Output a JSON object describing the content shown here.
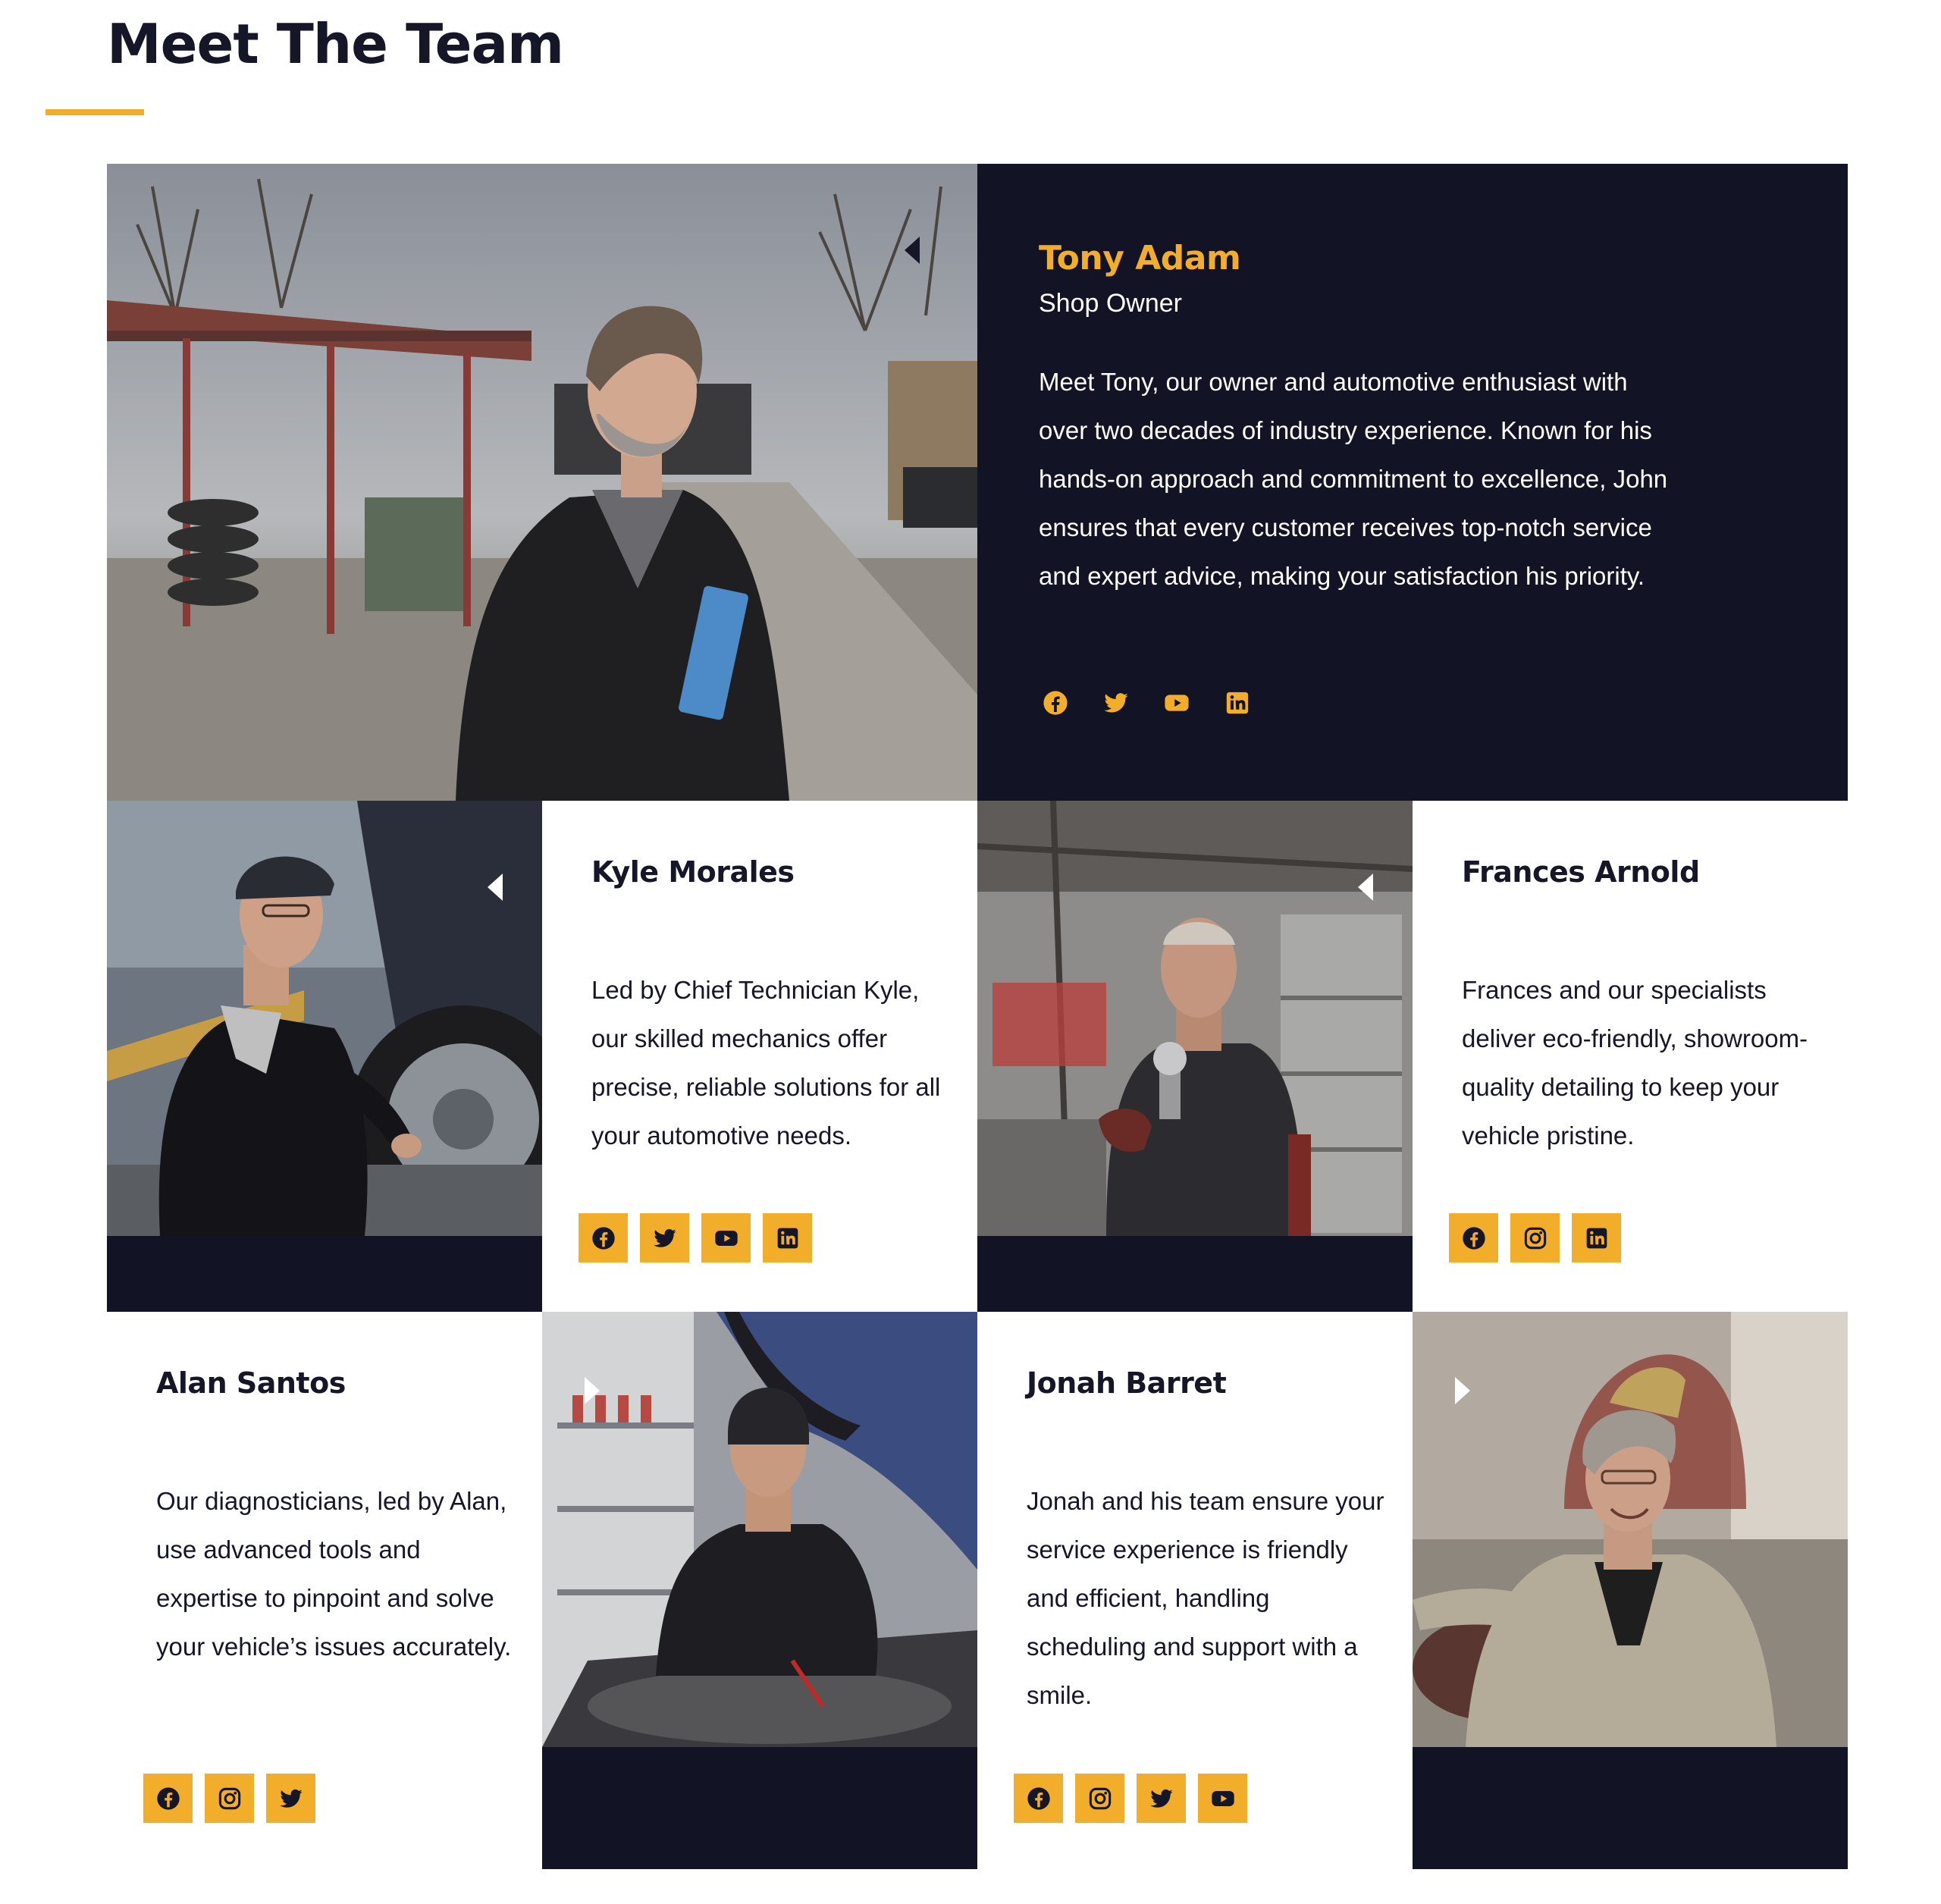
{
  "section": {
    "title": "Meet The Team"
  },
  "colors": {
    "accent": "#F2AE2A",
    "navy": "#131326",
    "text_dark": "#151628",
    "background": "#FFFFFF"
  },
  "members": [
    {
      "name": "Tony Adam",
      "role": "Shop Owner",
      "bio": "Meet Tony, our owner and automotive enthusiast with over two decades of industry experience. Known for his hands-on approach and commitment to excellence, John ensures that every customer receives top-notch service and expert advice, making your satisfaction his priority.",
      "photo": "Man in dark jacket holding a blue folder in an outdoor scrapyard",
      "socials": [
        "facebook-icon",
        "twitter-icon",
        "youtube-icon",
        "linkedin-icon"
      ]
    },
    {
      "name": "Kyle Morales",
      "bio": "Led by Chief Technician Kyle, our skilled mechanics offer precise, reliable solutions for all your automotive needs.",
      "photo": "Mechanic in cap fitting a car wheel",
      "socials": [
        "facebook-icon",
        "twitter-icon",
        "youtube-icon",
        "linkedin-icon"
      ]
    },
    {
      "name": "Frances Arnold",
      "bio": "Frances and our specialists deliver eco-friendly, showroom-quality detailing to keep your vehicle pristine.",
      "photo": "Worker holding a spray gun in a workshop",
      "socials": [
        "facebook-icon",
        "instagram-icon",
        "linkedin-icon"
      ]
    },
    {
      "name": "Alan Santos",
      "bio": "Our diagnosticians, led by Alan, use advanced tools and expertise to pinpoint and solve your vehicle’s issues accurately.",
      "photo": "Mechanic in beanie working under an open hood",
      "socials": [
        "facebook-icon",
        "instagram-icon",
        "twitter-icon"
      ]
    },
    {
      "name": "Jonah Barret",
      "bio": "Jonah and his team ensure your service experience is friendly and efficient, handling scheduling and support with a smile.",
      "photo": "Smiling man in grey hoodie in a garage",
      "socials": [
        "facebook-icon",
        "instagram-icon",
        "twitter-icon",
        "youtube-icon"
      ]
    }
  ]
}
